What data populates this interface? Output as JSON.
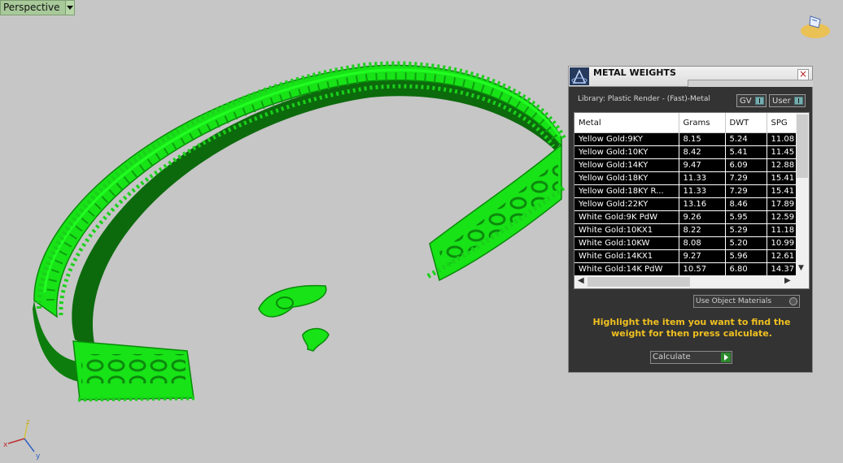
{
  "viewport": {
    "label": "Perspective",
    "model_color": "#17e317",
    "background": "#c6c6c6",
    "axes": {
      "x": "x",
      "y": "y",
      "z": "z"
    }
  },
  "panel": {
    "title": "METAL WEIGHTS",
    "close_label": "×",
    "library": "Library: Plastic Render - (Fast)-Metal",
    "gv_label": "GV",
    "user_label": "User",
    "table": {
      "headers": [
        "Metal",
        "Grams",
        "DWT",
        "SPG"
      ],
      "rows": [
        [
          "Yellow Gold:9KY",
          "8.15",
          "5.24",
          "11.08"
        ],
        [
          "Yellow Gold:10KY",
          "8.42",
          "5.41",
          "11.45"
        ],
        [
          "Yellow Gold:14KY",
          "9.47",
          "6.09",
          "12.88"
        ],
        [
          "Yellow Gold:18KY",
          "11.33",
          "7.29",
          "15.41"
        ],
        [
          "Yellow Gold:18KY R...",
          "11.33",
          "7.29",
          "15.41"
        ],
        [
          "Yellow Gold:22KY",
          "13.16",
          "8.46",
          "17.89"
        ],
        [
          "White Gold:9K PdW",
          "9.26",
          "5.95",
          "12.59"
        ],
        [
          "White Gold:10KX1",
          "8.22",
          "5.29",
          "11.18"
        ],
        [
          "White Gold:10KW",
          "8.08",
          "5.20",
          "10.99"
        ],
        [
          "White Gold:14KX1",
          "9.27",
          "5.96",
          "12.61"
        ],
        [
          "White Gold:14K PdW",
          "10.57",
          "6.80",
          "14.37"
        ]
      ]
    },
    "use_object_materials": "Use Object Materials",
    "hint": "Highlight the item you want to find the weight for then press calculate.",
    "calculate_label": "Calculate",
    "accent_color": "#f0c020"
  }
}
